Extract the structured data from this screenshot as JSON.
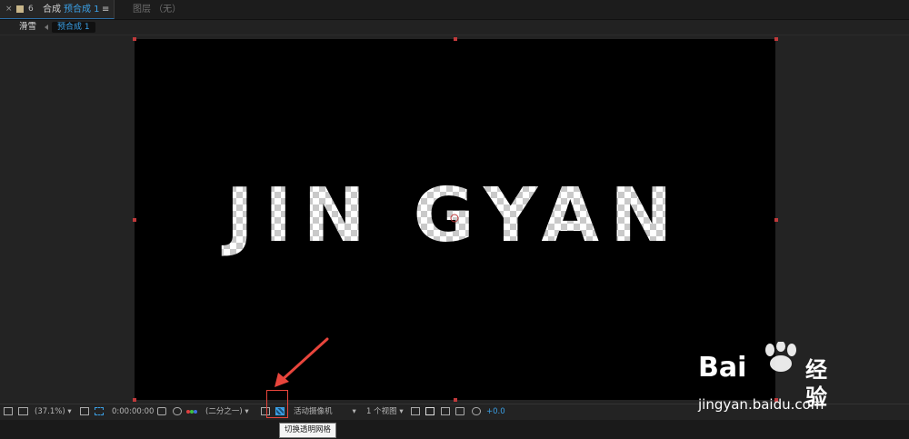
{
  "tabs": {
    "close_glyph": "×",
    "lock_glyph": "6",
    "comp_label": "合成",
    "comp_name": "预合成 1",
    "menu_glyph": "≡",
    "layer_label": "图层",
    "layer_value": "（无）"
  },
  "breadcrumb": {
    "parent": "滑雪",
    "current": "预合成 1"
  },
  "composition": {
    "text": "JIN GYAN",
    "background": "#000000",
    "handle_color": "#c0393b"
  },
  "toolbar": {
    "zoom": "(37.1%)",
    "timecode": "0:00:00:00",
    "resolution": "(二分之一)",
    "camera": "活动摄像机",
    "views": "1 个视图",
    "exposure": "+0.0",
    "accent_color": "#3ba0e6"
  },
  "tooltip": "切换透明网格",
  "annotation": {
    "color": "#e8453c"
  },
  "watermark": {
    "brand_left": "Bai",
    "brand_right": "经验",
    "url": "jingyan.baidu.com"
  }
}
